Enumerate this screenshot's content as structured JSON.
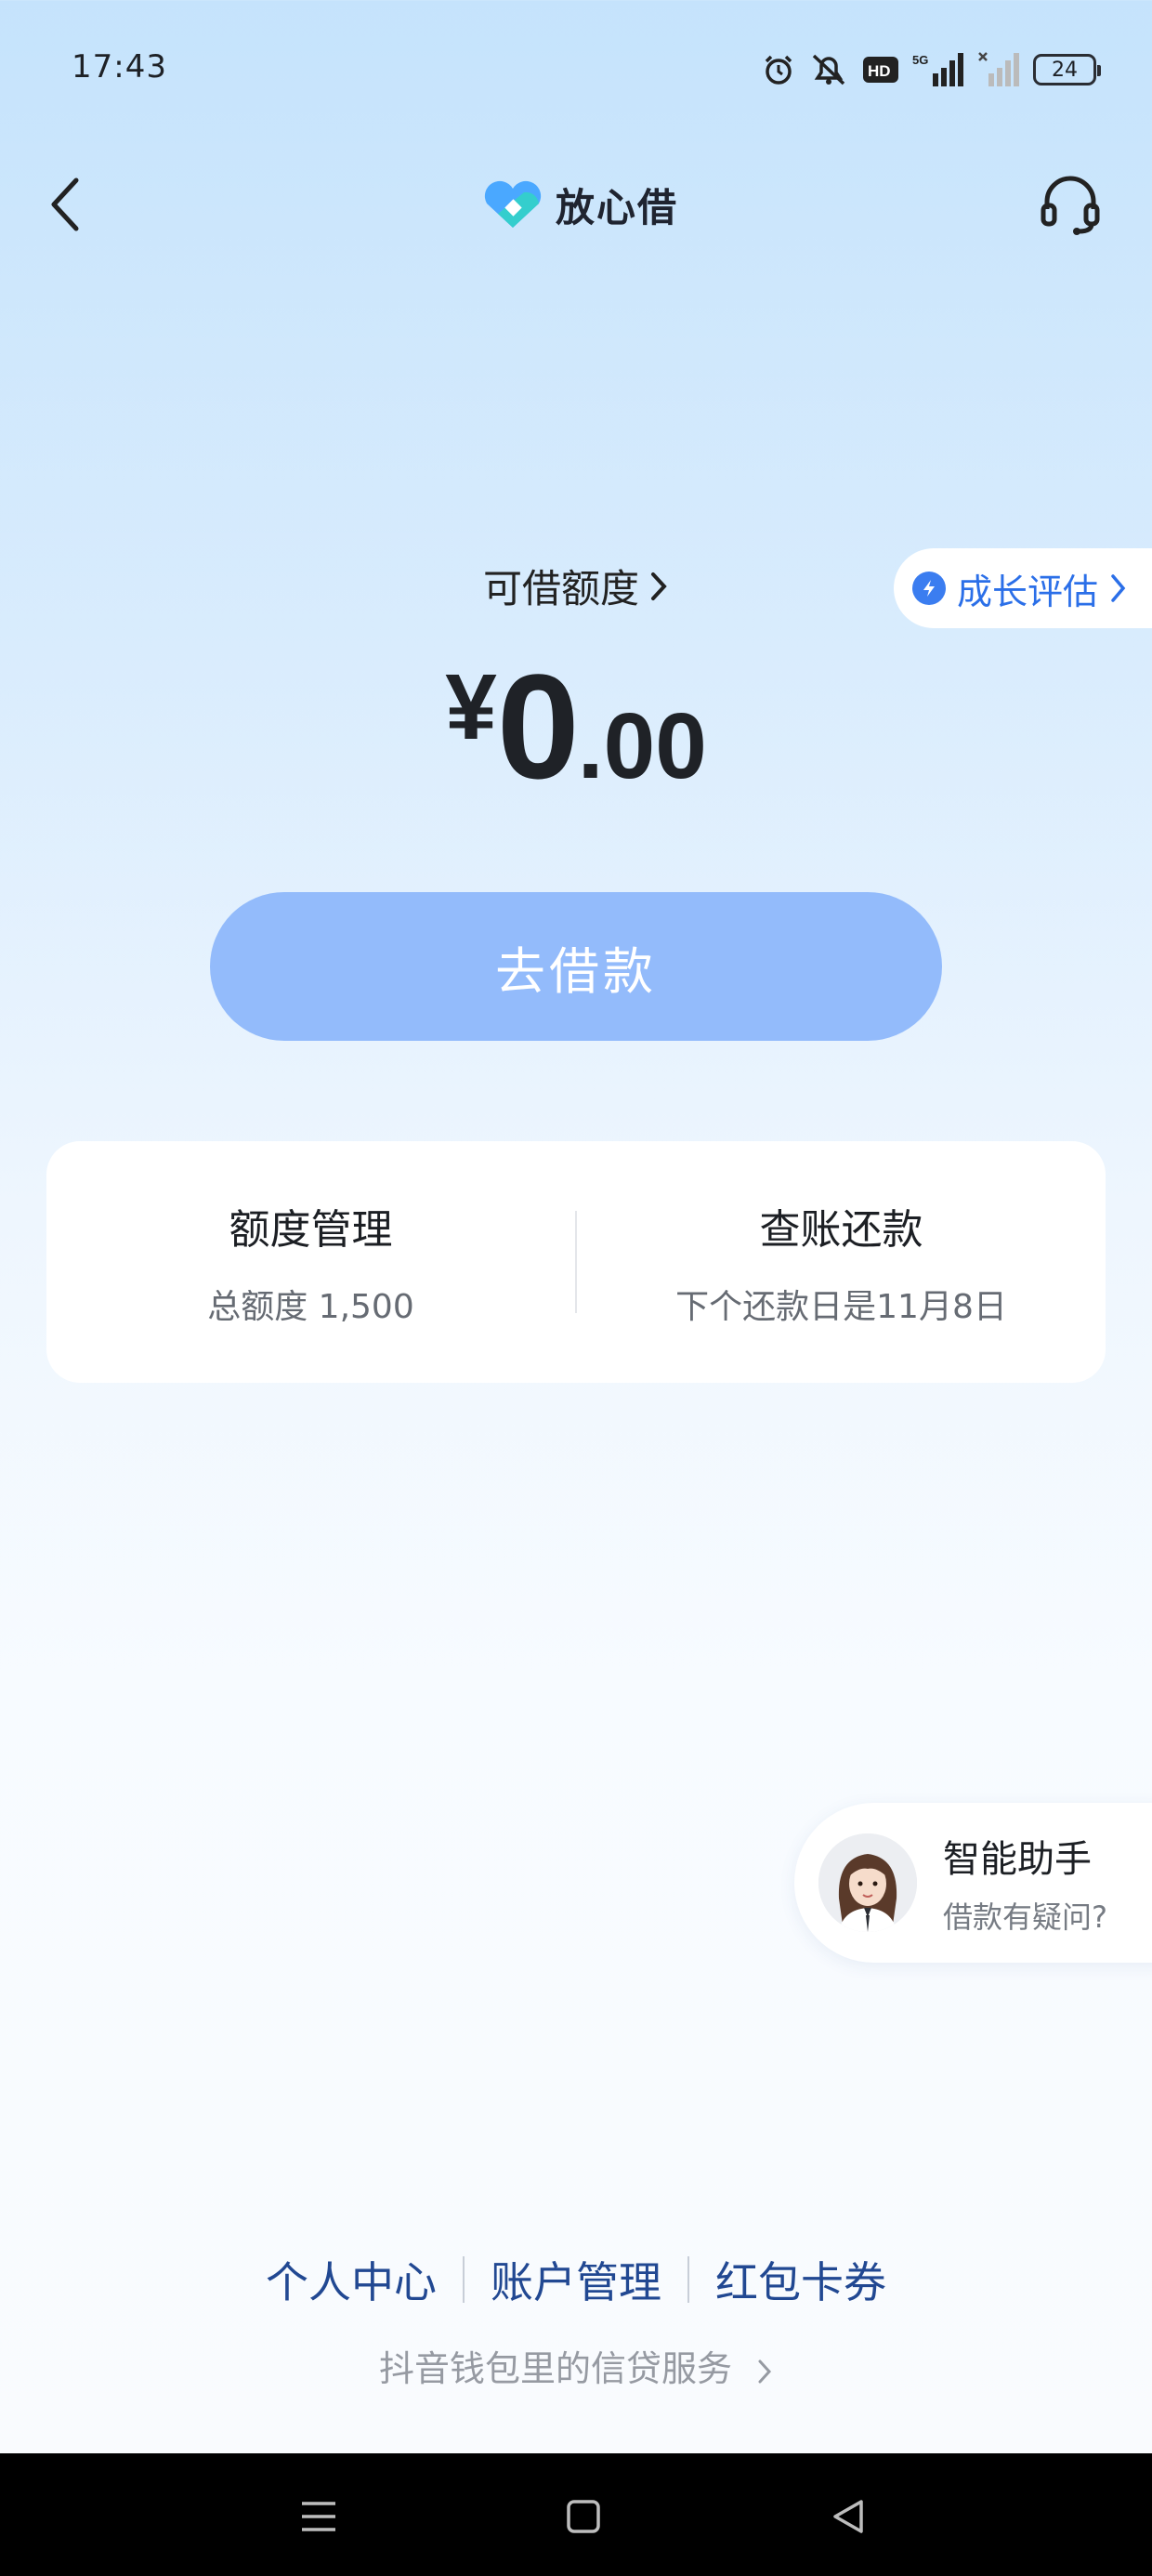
{
  "status_bar": {
    "time": "17:43",
    "network": "5G",
    "battery": "24"
  },
  "header": {
    "title": "放心借",
    "brand_colors": [
      "#4aa8ff",
      "#32d2c8"
    ]
  },
  "credit": {
    "label": "可借额度",
    "currency": "¥",
    "amount_int": "0",
    "amount_dec": ".00",
    "growth_label": "成长评估"
  },
  "borrow_button": {
    "label": "去借款",
    "color": "#93bbfb"
  },
  "summary": {
    "limit": {
      "title": "额度管理",
      "sub": "总额度 1,500"
    },
    "bill": {
      "title": "查账还款",
      "sub": "下个还款日是11月8日"
    }
  },
  "assistant": {
    "title": "智能助手",
    "sub": "借款有疑问?"
  },
  "footer": {
    "links": [
      "个人中心",
      "账户管理",
      "红包卡券"
    ],
    "service": "抖音钱包里的信贷服务"
  },
  "icons": {
    "back": "chevron-left-icon",
    "support": "headset-icon",
    "alarm": "alarm-icon",
    "mute": "bell-off-icon",
    "hd": "hd-icon",
    "signal": "signal-icon",
    "battery": "battery-icon",
    "menu": "menu-icon",
    "home": "home-icon",
    "back_sys": "triangle-back-icon"
  }
}
